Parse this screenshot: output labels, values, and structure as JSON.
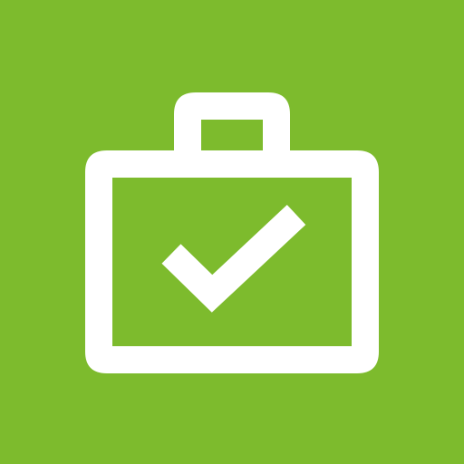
{
  "app_tile": {
    "icon": "briefcase-check-icon",
    "colors": {
      "background": "#7DBB2D",
      "foreground": "#FFFFFF"
    }
  }
}
